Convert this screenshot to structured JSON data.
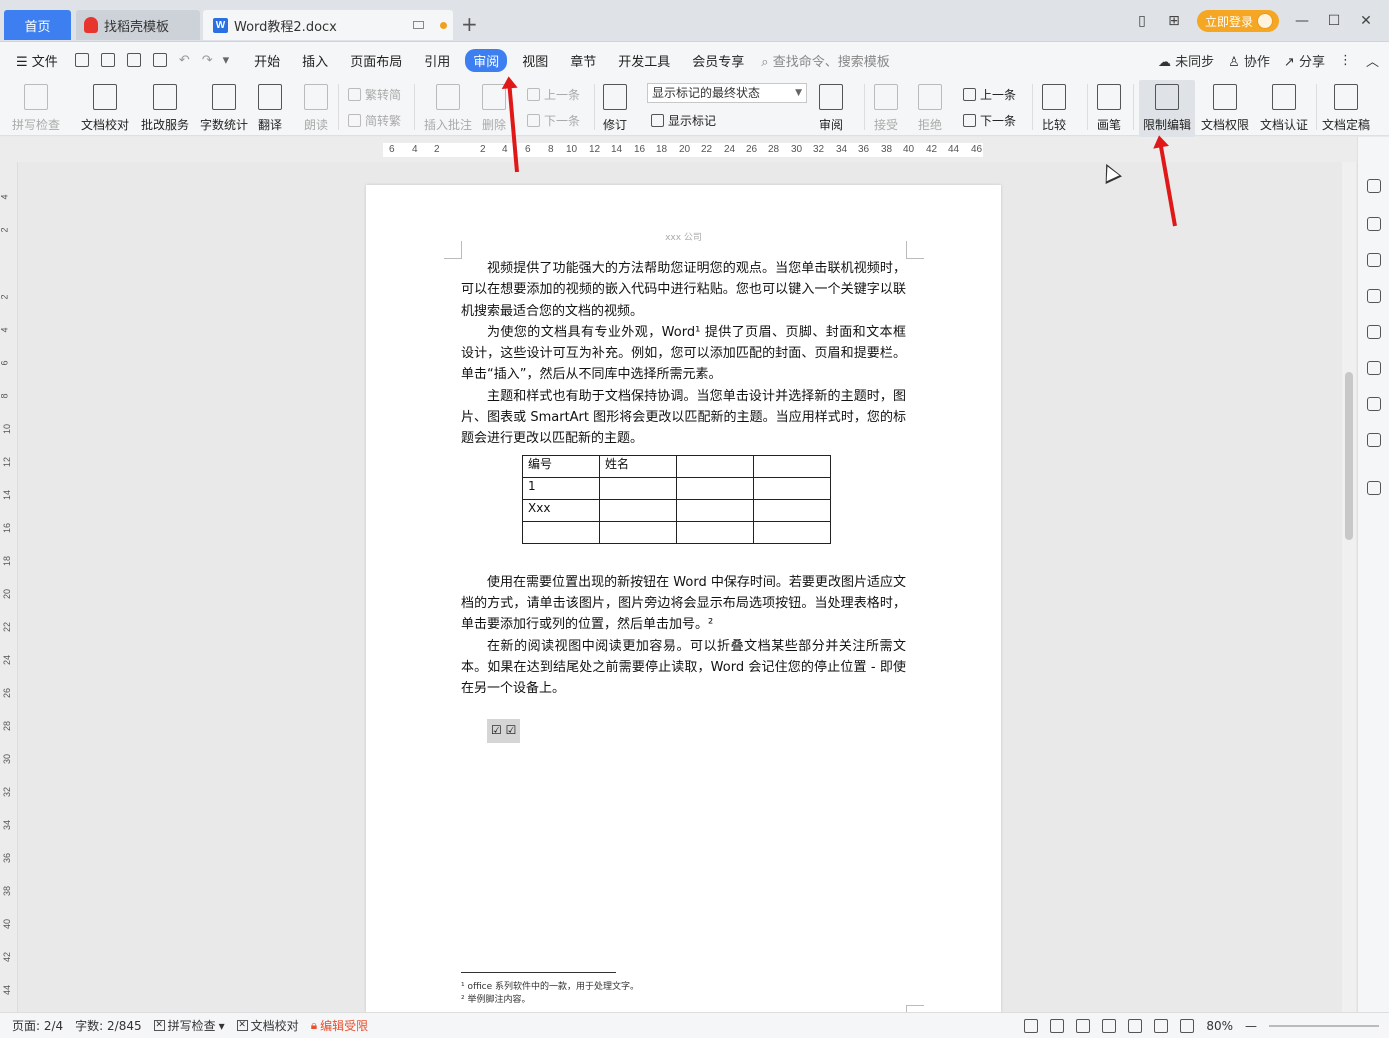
{
  "tabs": {
    "home": "首页",
    "template": "找稻壳模板",
    "document": "Word教程2.docx",
    "add": "+"
  },
  "titlebar": {
    "login": "立即登录"
  },
  "menu": {
    "file": "文件",
    "items": [
      "开始",
      "插入",
      "页面布局",
      "引用",
      "审阅",
      "视图",
      "章节",
      "开发工具",
      "会员专享"
    ],
    "active": "审阅",
    "search_placeholder": "查找命令、搜索模板",
    "sync": "未同步",
    "collab": "协作",
    "share": "分享"
  },
  "ribbon": {
    "spellcheck": "拼写检查",
    "proofread": "文档校对",
    "correction": "批改服务",
    "wordcount": "字数统计",
    "translate": "翻译",
    "read": "朗读",
    "to_simplified": "繁转简",
    "to_traditional": "简转繁",
    "insert_comment": "插入批注",
    "delete": "删除",
    "prev": "上一条",
    "next": "下一条",
    "track": "修订",
    "markup_state": "显示标记的最终状态",
    "show_markup": "显示标记",
    "review": "审阅",
    "accept": "接受",
    "reject": "拒绝",
    "prev2": "上一条",
    "next2": "下一条",
    "compare": "比较",
    "pen": "画笔",
    "restrict": "限制编辑",
    "permission": "文档权限",
    "certify": "文档认证",
    "finalize": "文档定稿"
  },
  "ruler": {
    "h_ticks": [
      "6",
      "4",
      "2",
      "2",
      "4",
      "6",
      "8",
      "10",
      "12",
      "14",
      "16",
      "18",
      "20",
      "22",
      "24",
      "26",
      "28",
      "30",
      "32",
      "34",
      "36",
      "38",
      "40",
      "42",
      "44",
      "46"
    ],
    "v_ticks": [
      "4",
      "2",
      "2",
      "4",
      "6",
      "8",
      "10",
      "12",
      "14",
      "16",
      "18",
      "20",
      "22",
      "24",
      "26",
      "28",
      "30",
      "32",
      "34",
      "36",
      "38",
      "40",
      "42",
      "44"
    ]
  },
  "document": {
    "header": "xxx 公司",
    "paragraphs": [
      "视频提供了功能强大的方法帮助您证明您的观点。当您单击联机视频时，可以在想要添加的视频的嵌入代码中进行粘贴。您也可以键入一个关键字以联机搜索最适合您的文档的视频。",
      "为使您的文档具有专业外观，Word¹ 提供了页眉、页脚、封面和文本框设计，这些设计可互为补充。例如，您可以添加匹配的封面、页眉和提要栏。单击“插入”，然后从不同库中选择所需元素。",
      "主题和样式也有助于文档保持协调。当您单击设计并选择新的主题时，图片、图表或 SmartArt 图形将会更改以匹配新的主题。当应用样式时，您的标题会进行更改以匹配新的主题。"
    ],
    "table": [
      [
        "编号",
        "姓名",
        "",
        ""
      ],
      [
        "1",
        "",
        "",
        ""
      ],
      [
        "Xxx",
        "",
        "",
        ""
      ],
      [
        "",
        "",
        "",
        ""
      ]
    ],
    "paragraphs2": [
      "使用在需要位置出现的新按钮在 Word 中保存时间。若要更改图片适应文档的方式，请单击该图片，图片旁边将会显示布局选项按钮。当处理表格时，单击要添加行或列的位置，然后单击加号。²",
      "在新的阅读视图中阅读更加容易。可以折叠文档某些部分并关注所需文本。如果在达到结尾处之前需要停止读取，Word 会记住您的停止位置 - 即使在另一个设备上。"
    ],
    "checkboxes": "☑ ☑",
    "footnote1": "¹  office 系列软件中的一款，用于处理文字。",
    "footnote2": "²  举例脚注内容。"
  },
  "status": {
    "page": "页面: 2/4",
    "words": "字数: 2/845",
    "spellcheck": "拼写检查",
    "proofread": "文档校对",
    "restricted": "编辑受限",
    "zoom": "80%"
  },
  "colors": {
    "accent": "#3d7ff0",
    "login": "#f5a623",
    "annotation": "#e01818"
  }
}
